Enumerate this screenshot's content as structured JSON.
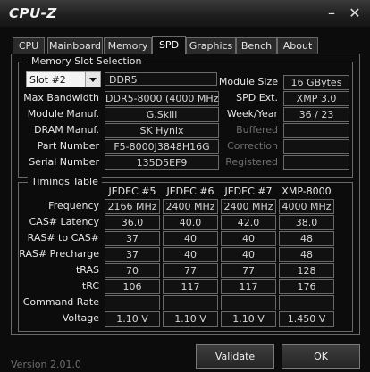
{
  "window": {
    "title": "CPU-Z",
    "minimize_glyph": "–",
    "close_glyph": "✕"
  },
  "tabs": [
    {
      "label": "CPU"
    },
    {
      "label": "Mainboard"
    },
    {
      "label": "Memory"
    },
    {
      "label": "SPD"
    },
    {
      "label": "Graphics"
    },
    {
      "label": "Bench"
    },
    {
      "label": "About"
    }
  ],
  "active_tab": "SPD",
  "slot_section": {
    "title": "Memory Slot Selection",
    "selected_slot": "Slot #2",
    "memory_type": "DDR5",
    "rows": [
      {
        "label": "Max Bandwidth",
        "value": "DDR5-8000 (4000 MHz)"
      },
      {
        "label": "Module Manuf.",
        "value": "G.Skill"
      },
      {
        "label": "DRAM Manuf.",
        "value": "SK Hynix"
      },
      {
        "label": "Part Number",
        "value": "F5-8000J3848H16G"
      },
      {
        "label": "Serial Number",
        "value": "135D5EF9"
      }
    ],
    "right_rows": [
      {
        "label": "Module Size",
        "value": "16 GBytes",
        "enabled": true
      },
      {
        "label": "SPD Ext.",
        "value": "XMP 3.0",
        "enabled": true
      },
      {
        "label": "Week/Year",
        "value": "36 / 23",
        "enabled": true
      },
      {
        "label": "Buffered",
        "value": "",
        "enabled": false
      },
      {
        "label": "Correction",
        "value": "",
        "enabled": false
      },
      {
        "label": "Registered",
        "value": "",
        "enabled": false
      }
    ]
  },
  "timings": {
    "title": "Timings Table",
    "columns": [
      "JEDEC #5",
      "JEDEC #6",
      "JEDEC #7",
      "XMP-8000"
    ],
    "rows": [
      {
        "label": "Frequency",
        "values": [
          "2166 MHz",
          "2400 MHz",
          "2400 MHz",
          "4000 MHz"
        ]
      },
      {
        "label": "CAS# Latency",
        "values": [
          "36.0",
          "40.0",
          "42.0",
          "38.0"
        ]
      },
      {
        "label": "RAS# to CAS#",
        "values": [
          "37",
          "40",
          "40",
          "48"
        ]
      },
      {
        "label": "RAS# Precharge",
        "values": [
          "37",
          "40",
          "40",
          "48"
        ]
      },
      {
        "label": "tRAS",
        "values": [
          "70",
          "77",
          "77",
          "128"
        ]
      },
      {
        "label": "tRC",
        "values": [
          "106",
          "117",
          "117",
          "176"
        ]
      },
      {
        "label": "Command Rate",
        "values": [
          "",
          "",
          "",
          ""
        ]
      },
      {
        "label": "Voltage",
        "values": [
          "1.10 V",
          "1.10 V",
          "1.10 V",
          "1.450 V"
        ]
      }
    ]
  },
  "footer": {
    "version": "Version 2.01.0",
    "validate_label": "Validate",
    "ok_label": "OK"
  },
  "colors": {
    "background": "#0c0c0c",
    "border": "#6a6a6a",
    "text": "#e8e8e8",
    "disabled_text": "#6e6e6e"
  }
}
